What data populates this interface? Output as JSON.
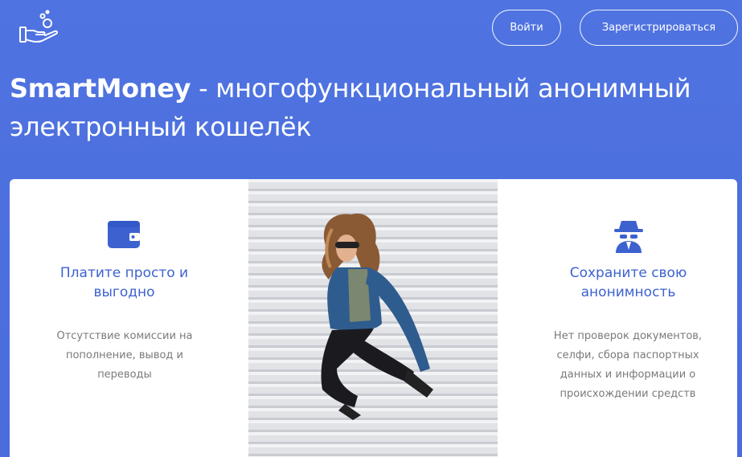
{
  "header": {
    "logo_icon": "hand-coins-icon",
    "login_label": "Войти",
    "register_label": "Зарегистрироваться"
  },
  "hero": {
    "brand": "SmartMoney",
    "tagline": " - многофункциональный анонимный электронный кошелёк"
  },
  "features": [
    {
      "icon": "wallet-icon",
      "title": "Платите просто и выгодно",
      "description": "Отсутствие комиссии на пополнение, вывод и переводы"
    },
    {
      "icon": "spy-icon",
      "title": "Сохраните свою анонимность",
      "description": "Нет проверок документов, селфи, сбора паспортных данных и информации о происхождении средств"
    }
  ],
  "colors": {
    "background": "#4f73e0",
    "accent": "#3d62cf",
    "text_muted": "#7a7a7a"
  }
}
